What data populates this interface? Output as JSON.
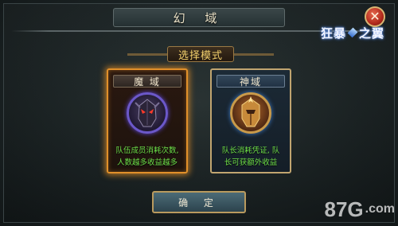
{
  "dialog": {
    "title": "幻 域",
    "close_icon": "close-icon",
    "logo_text_left": "狂",
    "logo_text_mid": "暴",
    "logo_text_right": "之翼"
  },
  "mode_select": {
    "label": "选择模式"
  },
  "cards": [
    {
      "id": "mo",
      "title": "魔 域",
      "desc_line1": "队伍成员消耗次数,",
      "desc_line2": "人数越多收益越多",
      "selected": true
    },
    {
      "id": "shen",
      "title": "神域",
      "desc_line1": "队长消耗凭证, 队",
      "desc_line2": "长可获额外收益",
      "selected": false
    }
  ],
  "confirm_label": "确 定",
  "watermark": {
    "main": "87G",
    "suffix": ".com"
  },
  "colors": {
    "selected_border": "#e1902a",
    "desc_text": "#6fe04a",
    "title_text": "#f3d06c"
  }
}
